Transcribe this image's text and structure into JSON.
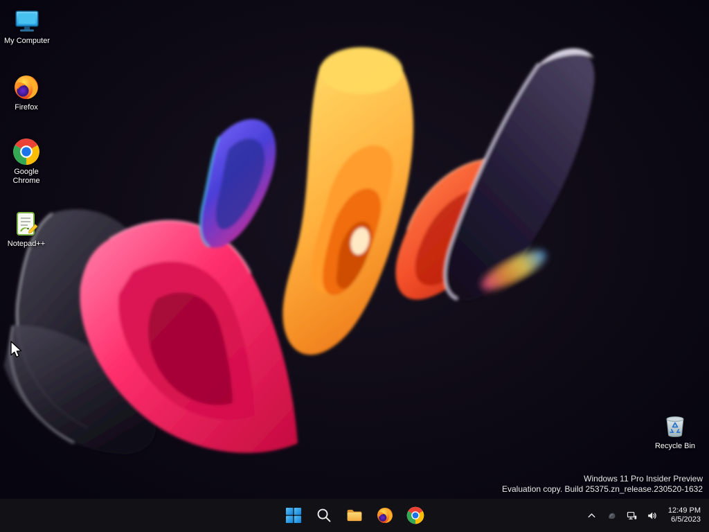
{
  "desktop": {
    "icons": [
      {
        "label": "My Computer",
        "icon": "computer-icon"
      },
      {
        "label": "Firefox",
        "icon": "firefox-icon"
      },
      {
        "label": "Google Chrome",
        "icon": "chrome-icon"
      },
      {
        "label": "Notepad++",
        "icon": "notepadpp-icon"
      },
      {
        "label": "Recycle Bin",
        "icon": "recycle-bin-icon"
      }
    ],
    "watermark": {
      "line1": "Windows 11 Pro Insider Preview",
      "line2": "Evaluation copy. Build 25375.zn_release.230520-1632"
    }
  },
  "taskbar": {
    "buttons": [
      {
        "name": "Start",
        "icon": "windows-start-icon"
      },
      {
        "name": "Search",
        "icon": "search-icon"
      },
      {
        "name": "File Explorer",
        "icon": "folder-icon"
      },
      {
        "name": "Firefox",
        "icon": "firefox-icon"
      },
      {
        "name": "Google Chrome",
        "icon": "chrome-icon"
      }
    ],
    "tray": {
      "chevron": "chevron-up-icon",
      "icons": [
        "tray-misc-icon",
        "network-icon",
        "volume-icon"
      ],
      "time": "12:49 PM",
      "date": "6/5/2023"
    }
  },
  "colors": {
    "taskbar_bg": "#121216",
    "desktop_label": "#ffffff",
    "watermark": "#eaeaea",
    "start_blue": "#2f9df4"
  }
}
